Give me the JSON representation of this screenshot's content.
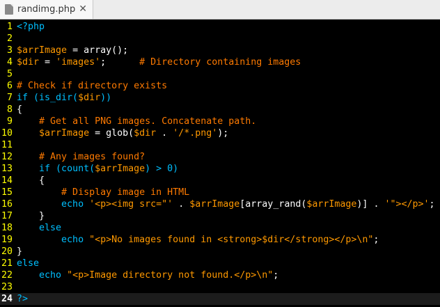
{
  "tab": {
    "title": "randimg.php",
    "file_icon_label": "php",
    "close": "✕"
  },
  "editor": {
    "current_line": 24,
    "colors": {
      "background": "#000000",
      "line_number": "#ffff00",
      "keyword": "#00bfff",
      "variable": "#ff9900",
      "string": "#ff9900",
      "comment": "#ff7a00",
      "text": "#ffffff"
    },
    "lines": [
      {
        "n": "1",
        "tokens": [
          {
            "t": "<?php",
            "c": "kw"
          }
        ]
      },
      {
        "n": "2",
        "tokens": []
      },
      {
        "n": "3",
        "tokens": [
          {
            "t": "$arrImage",
            "c": "var"
          },
          {
            "t": " = array();",
            "c": "def"
          }
        ]
      },
      {
        "n": "4",
        "tokens": [
          {
            "t": "$dir",
            "c": "var"
          },
          {
            "t": " = ",
            "c": "def"
          },
          {
            "t": "'images'",
            "c": "str"
          },
          {
            "t": ";      ",
            "c": "def"
          },
          {
            "t": "# Directory containing images",
            "c": "cmt"
          }
        ]
      },
      {
        "n": "5",
        "tokens": []
      },
      {
        "n": "6",
        "tokens": [
          {
            "t": "# Check if directory exists",
            "c": "cmt"
          }
        ]
      },
      {
        "n": "7",
        "tokens": [
          {
            "t": "if",
            "c": "kw"
          },
          {
            "t": " (is_dir(",
            "c": "kw"
          },
          {
            "t": "$dir",
            "c": "var"
          },
          {
            "t": "))",
            "c": "kw"
          }
        ]
      },
      {
        "n": "8",
        "tokens": [
          {
            "t": "{",
            "c": "def"
          }
        ]
      },
      {
        "n": "9",
        "tokens": [
          {
            "t": "    ",
            "c": "def"
          },
          {
            "t": "# Get all PNG images. Concatenate path.",
            "c": "cmt"
          }
        ]
      },
      {
        "n": "10",
        "tokens": [
          {
            "t": "    ",
            "c": "def"
          },
          {
            "t": "$arrImage",
            "c": "var"
          },
          {
            "t": " = glob(",
            "c": "def"
          },
          {
            "t": "$dir",
            "c": "var"
          },
          {
            "t": " . ",
            "c": "def"
          },
          {
            "t": "'/*.png'",
            "c": "str"
          },
          {
            "t": ");",
            "c": "def"
          }
        ]
      },
      {
        "n": "11",
        "tokens": []
      },
      {
        "n": "12",
        "tokens": [
          {
            "t": "    ",
            "c": "def"
          },
          {
            "t": "# Any images found?",
            "c": "cmt"
          }
        ]
      },
      {
        "n": "13",
        "tokens": [
          {
            "t": "    ",
            "c": "def"
          },
          {
            "t": "if",
            "c": "kw"
          },
          {
            "t": " (count(",
            "c": "kw"
          },
          {
            "t": "$arrImage",
            "c": "var"
          },
          {
            "t": ") > 0)",
            "c": "kw"
          }
        ]
      },
      {
        "n": "14",
        "tokens": [
          {
            "t": "    {",
            "c": "def"
          }
        ]
      },
      {
        "n": "15",
        "tokens": [
          {
            "t": "        ",
            "c": "def"
          },
          {
            "t": "# Display image in HTML",
            "c": "cmt"
          }
        ]
      },
      {
        "n": "16",
        "tokens": [
          {
            "t": "        ",
            "c": "def"
          },
          {
            "t": "echo",
            "c": "kw"
          },
          {
            "t": " ",
            "c": "def"
          },
          {
            "t": "'<p><img src=\"'",
            "c": "str"
          },
          {
            "t": " . ",
            "c": "def"
          },
          {
            "t": "$arrImage",
            "c": "var"
          },
          {
            "t": "[array_rand(",
            "c": "def"
          },
          {
            "t": "$arrImage",
            "c": "var"
          },
          {
            "t": ")] . ",
            "c": "def"
          },
          {
            "t": "'\"></p>'",
            "c": "str"
          },
          {
            "t": ";",
            "c": "def"
          }
        ]
      },
      {
        "n": "17",
        "tokens": [
          {
            "t": "    }",
            "c": "def"
          }
        ]
      },
      {
        "n": "18",
        "tokens": [
          {
            "t": "    ",
            "c": "def"
          },
          {
            "t": "else",
            "c": "kw"
          }
        ]
      },
      {
        "n": "19",
        "tokens": [
          {
            "t": "        ",
            "c": "def"
          },
          {
            "t": "echo",
            "c": "kw"
          },
          {
            "t": " ",
            "c": "def"
          },
          {
            "t": "\"<p>No images found in <strong>",
            "c": "str"
          },
          {
            "t": "$dir",
            "c": "var"
          },
          {
            "t": "</strong></p>\\n\"",
            "c": "str"
          },
          {
            "t": ";",
            "c": "def"
          }
        ]
      },
      {
        "n": "20",
        "tokens": [
          {
            "t": "}",
            "c": "def"
          }
        ]
      },
      {
        "n": "21",
        "tokens": [
          {
            "t": "else",
            "c": "kw"
          }
        ]
      },
      {
        "n": "22",
        "tokens": [
          {
            "t": "    ",
            "c": "def"
          },
          {
            "t": "echo",
            "c": "kw"
          },
          {
            "t": " ",
            "c": "def"
          },
          {
            "t": "\"<p>Image directory not found.</p>\\n\"",
            "c": "str"
          },
          {
            "t": ";",
            "c": "def"
          }
        ]
      },
      {
        "n": "23",
        "tokens": []
      },
      {
        "n": "24",
        "tokens": [
          {
            "t": "?>",
            "c": "kw"
          }
        ]
      }
    ]
  }
}
